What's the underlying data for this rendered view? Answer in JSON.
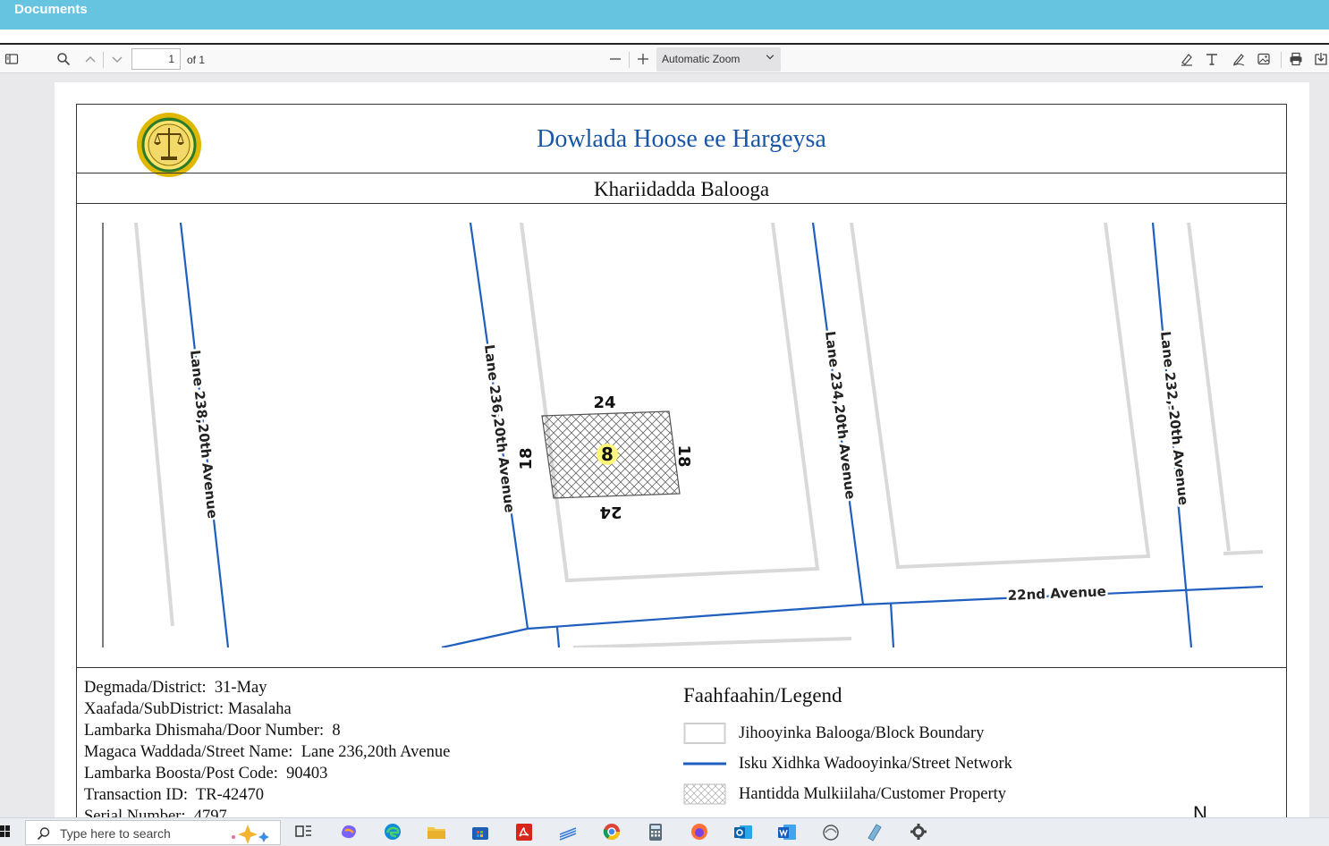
{
  "app": {
    "title": "Documents"
  },
  "toolbar": {
    "page_current": "1",
    "page_total_label": "of 1",
    "zoom_label": "Automatic Zoom",
    "icons": [
      "sidebar-toggle-icon",
      "search-icon",
      "chevron-up-icon",
      "chevron-down-icon",
      "zoom-out-icon",
      "zoom-in-icon",
      "highlight-icon",
      "text-icon",
      "draw-icon",
      "image-icon",
      "print-icon",
      "save-icon"
    ]
  },
  "document": {
    "title": "Dowlada Hoose ee Hargeysa",
    "subtitle": "Khariidadda Balooga",
    "map": {
      "streets": [
        "Lane 238,20th Avenue",
        "Lane 236,20th Avenue",
        "Lane 234,20th Avenue",
        "Lane 232,-20th Avenue",
        "22nd Avenue"
      ],
      "parcel": {
        "number": "8",
        "top": "24",
        "bottom": "24",
        "left": "18",
        "right": "18"
      }
    },
    "info": [
      {
        "label": "Degmada/District:",
        "value": "31-May"
      },
      {
        "label": "Xaafada/SubDistrict:",
        "value": "Masalaha"
      },
      {
        "label": "Lambarka Dhismaha/Door Number:",
        "value": "8"
      },
      {
        "label": "Magaca Waddada/Street Name:",
        "value": "Lane 236,20th Avenue"
      },
      {
        "label": "Lambarka Boosta/Post Code:",
        "value": "90403"
      },
      {
        "label": "Transaction ID:",
        "value": "TR-42470"
      },
      {
        "label": "Serial Number:",
        "value": "4797"
      }
    ],
    "legend": {
      "title": "Faahfaahin/Legend",
      "items": [
        "Jihooyinka Balooga/Block Boundary",
        "Isku Xidhka Wadooyinka/Street Network",
        "Hantidda Mulkiilaha/Customer Property"
      ]
    },
    "north_label": "N"
  },
  "taskbar": {
    "search_placeholder": "Type here to search"
  },
  "colors": {
    "titlebar": "#66c4e0",
    "street": "#1f5fbf",
    "title_text": "#1a56a8"
  }
}
